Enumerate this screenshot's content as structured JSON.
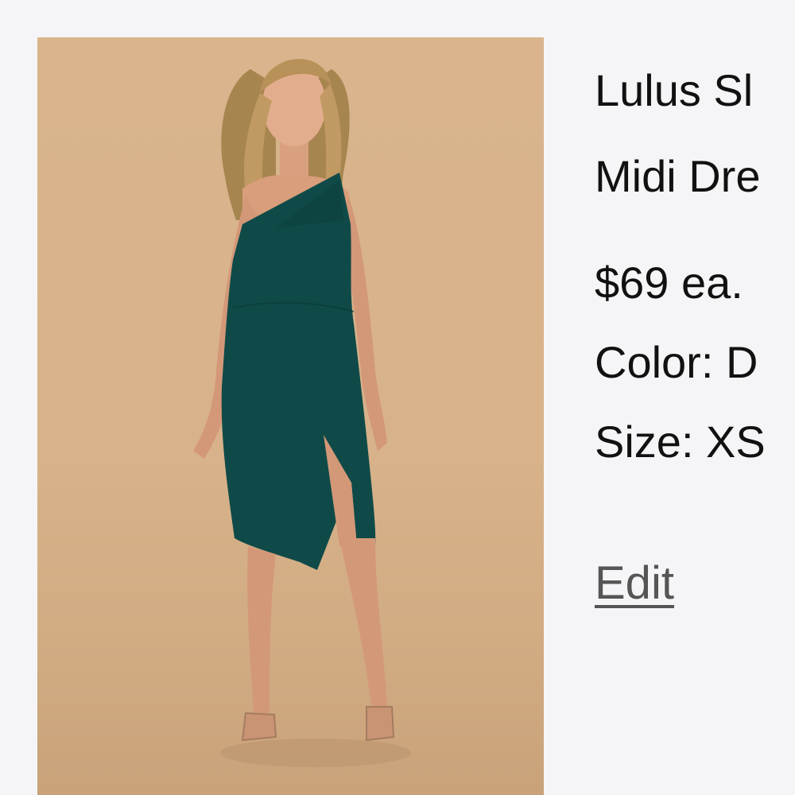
{
  "product": {
    "title_line1": "Lulus Sl",
    "title_line2": "Midi Dre",
    "price": "$69 ea.",
    "color": "Color: D",
    "size": "Size: XS",
    "edit_label": "Edit"
  },
  "colors": {
    "background": "#f5f5f7",
    "photo_background": "#d9b48d",
    "dress": "#0f4a48",
    "text": "#111111",
    "link": "#555555"
  }
}
